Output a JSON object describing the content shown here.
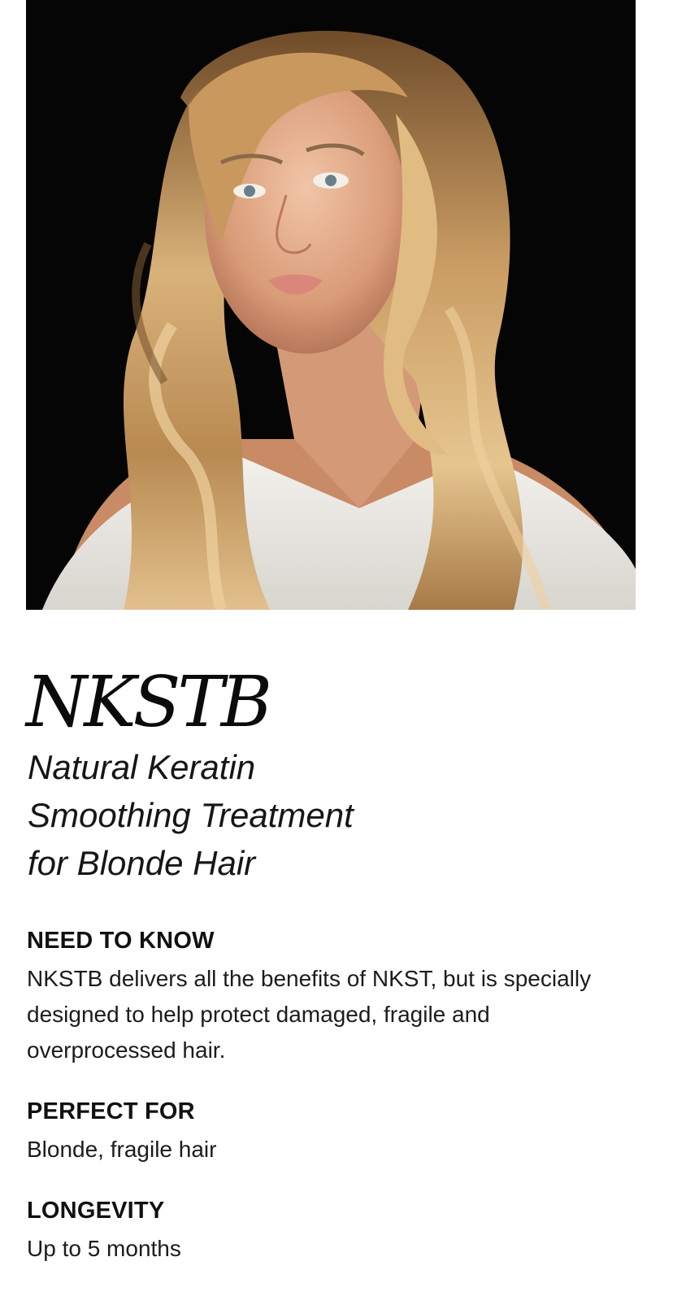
{
  "hero": {
    "image_subject": "portrait-blonde-wavy-hair",
    "background_color": "#050505"
  },
  "product": {
    "brand": "NKSTB",
    "subtitle_lines": [
      "Natural Keratin",
      "Smoothing Treatment",
      "for Blonde Hair"
    ]
  },
  "sections": [
    {
      "heading": "NEED TO KNOW",
      "body": "NKSTB delivers all the benefits of NKST, but is specially designed to help protect damaged, fragile and overprocessed hair."
    },
    {
      "heading": "PERFECT FOR",
      "body": "Blonde, fragile hair"
    },
    {
      "heading": "LONGEVITY",
      "body": "Up to 5 months"
    }
  ]
}
